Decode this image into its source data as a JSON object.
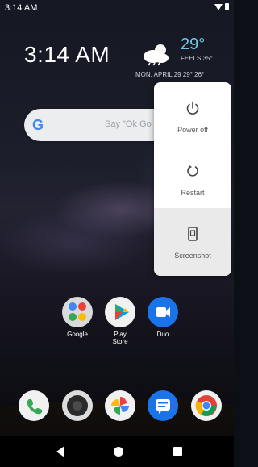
{
  "status_bar": {
    "time": "3:14 AM"
  },
  "clock": {
    "time": "3:14 AM"
  },
  "weather": {
    "temperature": "29°",
    "feels_like": "FEELS 35°",
    "date_line": "MON, APRIL 29  29° 26°"
  },
  "search": {
    "placeholder": "Say \"Ok Go"
  },
  "apps": {
    "row1": [
      {
        "label": "Google"
      },
      {
        "label": "Play\nStore"
      },
      {
        "label": "Duo"
      }
    ]
  },
  "power_menu": {
    "items": [
      {
        "label": "Power off",
        "icon": "power-icon"
      },
      {
        "label": "Restart",
        "icon": "restart-icon"
      },
      {
        "label": "Screenshot",
        "icon": "screenshot-icon"
      }
    ]
  },
  "colors": {
    "temp": "#6ec6e6",
    "menu_bg": "#ffffff",
    "menu_selected": "#eaeaea"
  }
}
